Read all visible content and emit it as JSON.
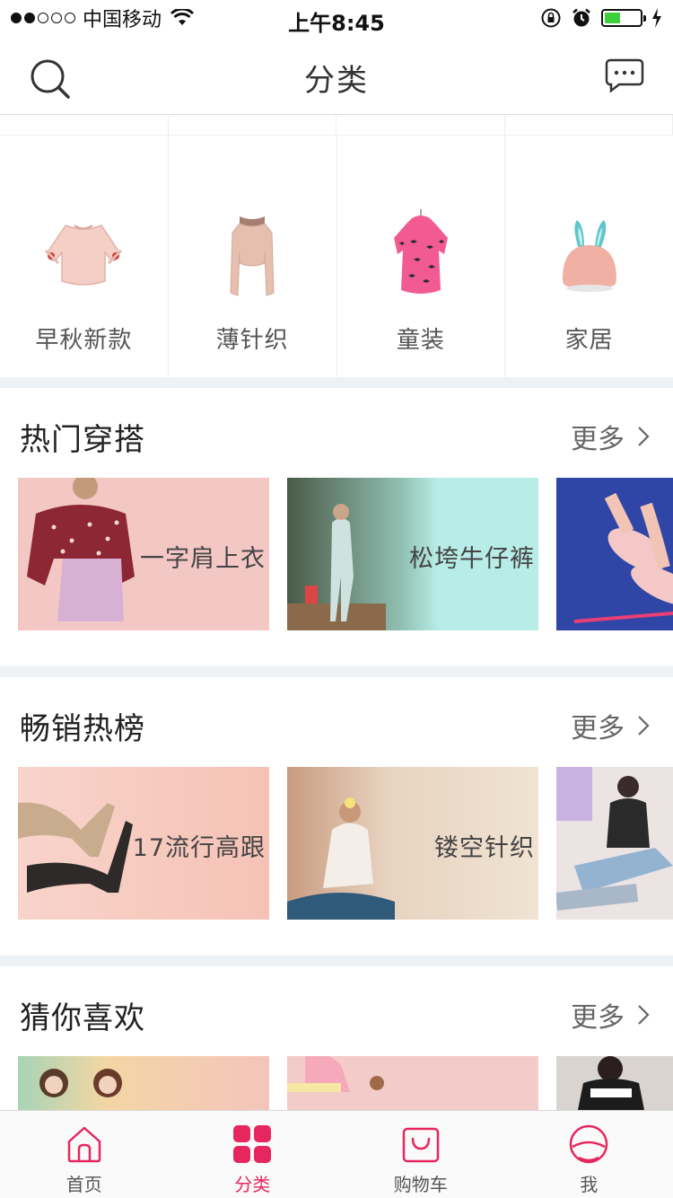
{
  "status_bar": {
    "carrier": "中国移动",
    "time": "上午8:45"
  },
  "nav": {
    "title": "分类",
    "left_icon": "search-icon",
    "right_icon": "message-icon"
  },
  "top_categories": [
    {
      "label": "早秋新款",
      "icon": "blouse-image"
    },
    {
      "label": "薄针织",
      "icon": "knit-top-image"
    },
    {
      "label": "童装",
      "icon": "kids-dress-image"
    },
    {
      "label": "家居",
      "icon": "bunny-lamp-image"
    }
  ],
  "sections": [
    {
      "title": "热门穿搭",
      "more": "更多",
      "banners": [
        {
          "label": "一字肩上衣"
        },
        {
          "label": "松垮牛仔裤"
        },
        {
          "label": ""
        }
      ]
    },
    {
      "title": "畅销热榜",
      "more": "更多",
      "banners": [
        {
          "label": "17流行高跟"
        },
        {
          "label": "镂空针织"
        },
        {
          "label": ""
        }
      ]
    },
    {
      "title": "猜你喜欢",
      "more": "更多",
      "banners": [
        {
          "label": ""
        },
        {
          "label": ""
        },
        {
          "label": ""
        }
      ]
    }
  ],
  "tab_bar": {
    "tabs": [
      {
        "label": "首页",
        "icon": "home-icon",
        "active": false
      },
      {
        "label": "分类",
        "icon": "category-grid-icon",
        "active": true
      },
      {
        "label": "购物车",
        "icon": "shopping-bag-icon",
        "active": false
      },
      {
        "label": "我",
        "icon": "profile-icon",
        "active": false
      }
    ]
  },
  "colors": {
    "accent": "#e6275f",
    "separator": "#eef2f5"
  }
}
